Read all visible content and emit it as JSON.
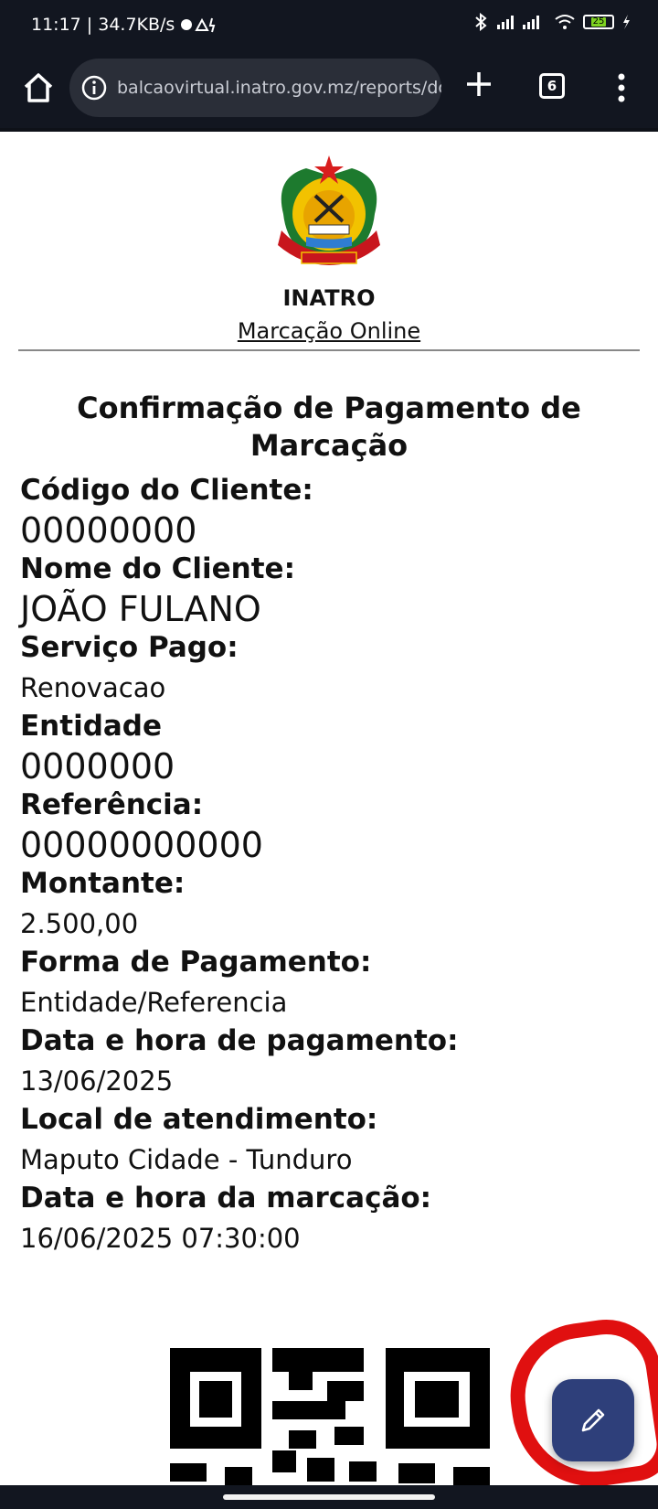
{
  "status_bar": {
    "time_speed": "11:17 | 34.7KB/s",
    "battery": "25"
  },
  "browser": {
    "url": "balcaovirtual.inatro.gov.mz/reports/dc",
    "tab_count": "6"
  },
  "header": {
    "org_name": "INATRO",
    "subtitle": "Marcação Online"
  },
  "document": {
    "title": "Confirmação de Pagamento de Marcação",
    "fields": [
      {
        "label": "Código do Cliente:",
        "value": "00000000"
      },
      {
        "label": "Nome do Cliente:",
        "value": "JOÃO FULANO"
      },
      {
        "label": "Serviço Pago:",
        "value": "Renovacao"
      },
      {
        "label": "Entidade",
        "value": "0000000"
      },
      {
        "label": "Referência:",
        "value": "00000000000"
      },
      {
        "label": "Montante:",
        "value": "2.500,00"
      },
      {
        "label": "Forma de Pagamento:",
        "value": "Entidade/Referencia"
      },
      {
        "label": "Data e hora de pagamento:",
        "value": "13/06/2025"
      },
      {
        "label": "Local de atendimento:",
        "value": "Maputo Cidade - Tunduro"
      },
      {
        "label": "Data e hora da marcação:",
        "value": "16/06/2025 07:30:00"
      }
    ]
  },
  "icons": {
    "home": "home-icon",
    "info": "info-icon",
    "plus": "plus-icon",
    "menu": "more-vert-icon",
    "fab": "pencil-icon",
    "emblem": "coat-of-arms-icon",
    "qr": "qr-code-icon"
  },
  "colors": {
    "system_bar": "#121620",
    "fab": "#2e3f7a",
    "highlight_ring": "#e01010"
  }
}
